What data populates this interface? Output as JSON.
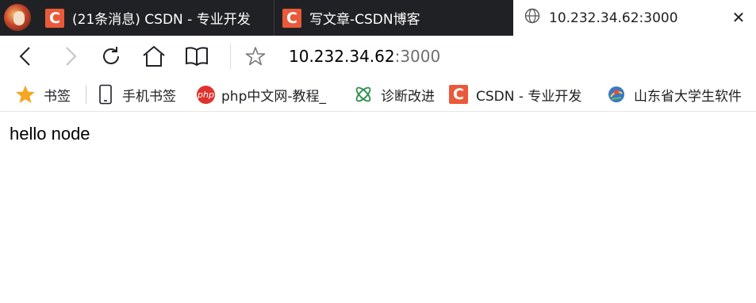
{
  "tabs": [
    {
      "title": "(21条消息) CSDN - 专业开发",
      "icon": "csdn-icon",
      "icon_text": "C"
    },
    {
      "title": "写文章-CSDN博客",
      "icon": "csdn-icon",
      "icon_text": "C"
    },
    {
      "title": "10.232.34.62:3000",
      "icon": "globe-icon",
      "close": "✕"
    }
  ],
  "address": {
    "host": "10.232.34.62",
    "port": ":3000"
  },
  "bookmarks": [
    {
      "label": "书签",
      "icon": "star-icon"
    },
    {
      "label": "手机书签",
      "icon": "phone-icon"
    },
    {
      "label": "php中文网-教程_手",
      "icon": "php-icon",
      "icon_text": "php"
    },
    {
      "label": "诊断改进",
      "icon": "atom-icon"
    },
    {
      "label": "CSDN - 专业开发",
      "icon": "csdn-icon",
      "icon_text": "C"
    },
    {
      "label": "山东省大学生软件",
      "icon": "badge-icon"
    }
  ],
  "page": {
    "text": "hello node"
  },
  "colors": {
    "tabbar": "#202124",
    "csdn": "#ea5a3a",
    "star": "#f5a623",
    "php": "#e0322d",
    "atom": "#2f8f4e"
  }
}
